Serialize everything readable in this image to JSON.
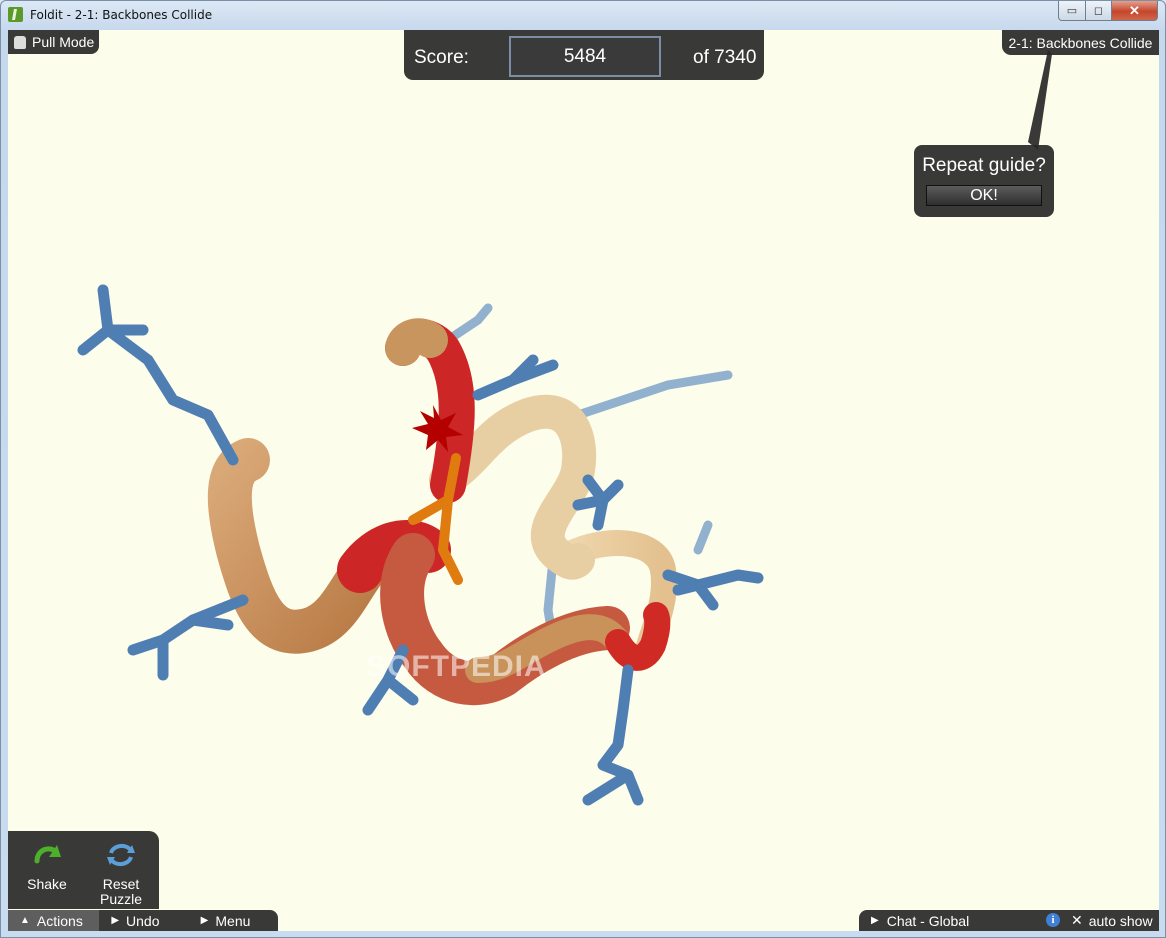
{
  "window": {
    "title": "Foldit - 2-1: Backbones Collide",
    "minimize_label": "▭",
    "maximize_label": "◻",
    "close_label": "✕"
  },
  "hud": {
    "mode_label": "Pull Mode",
    "score_label": "Score:",
    "score_value": "5484",
    "score_max": "of 7340",
    "puzzle_name": "2-1: Backbones Collide"
  },
  "guide": {
    "text": "Repeat guide?",
    "button_label": "OK!"
  },
  "watermark": "SOFTPEDIA",
  "actions": {
    "shake_label": "Shake",
    "reset_label_line1": "Reset",
    "reset_label_line2": "Puzzle"
  },
  "bottom_tabs": {
    "actions": "Actions",
    "undo": "Undo",
    "menu": "Menu"
  },
  "chat": {
    "label": "Chat - Global",
    "info_icon": "i",
    "autoshow_label": "auto show"
  },
  "colors": {
    "background": "#fdfdeb",
    "panel": "#282828",
    "sidechain": "#4f7eb3",
    "backbone_tan": "#c8925a",
    "backbone_red": "#cc2222",
    "highlight_orange": "#e07b10"
  }
}
